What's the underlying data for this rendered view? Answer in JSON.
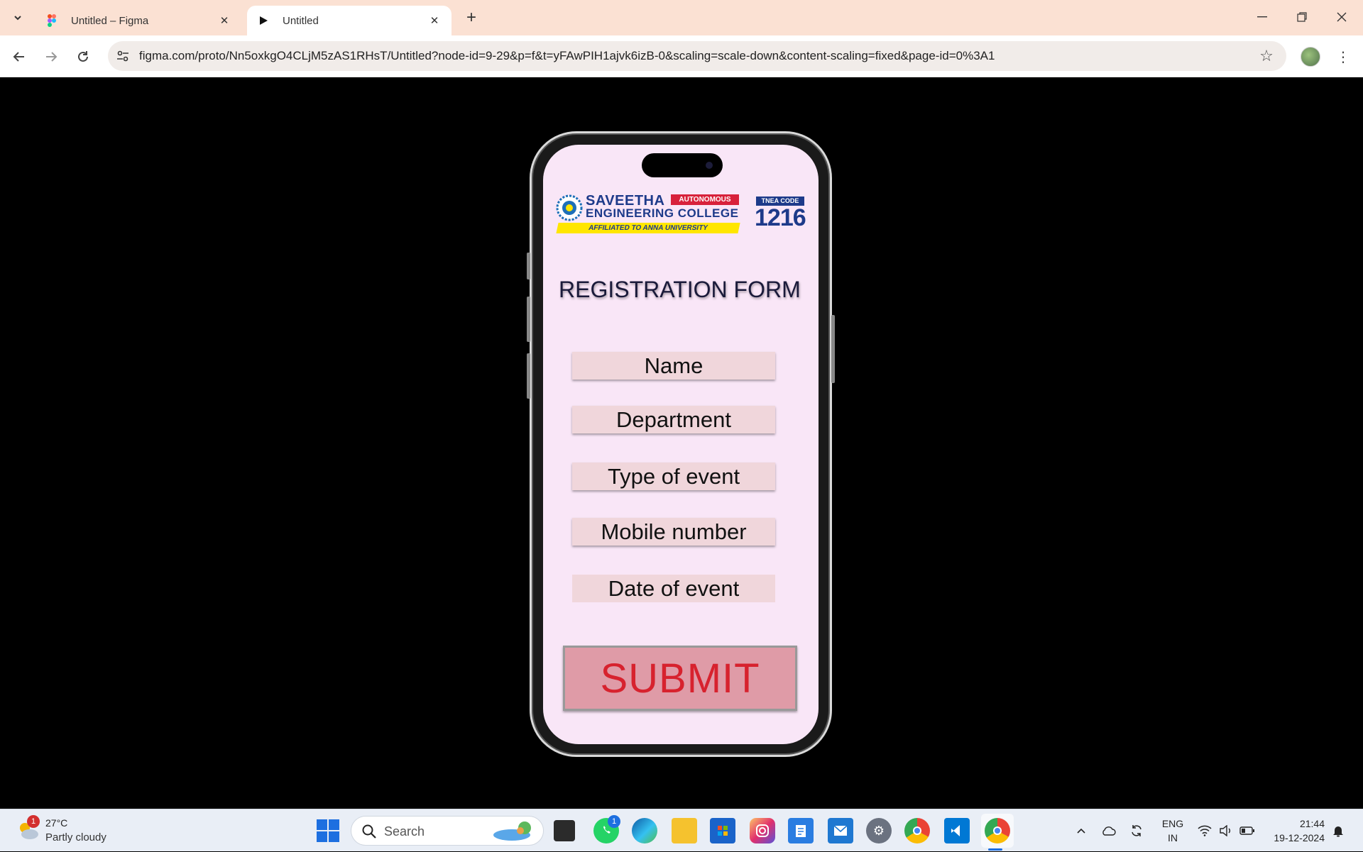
{
  "browser": {
    "tabs": [
      {
        "title": "Untitled – Figma",
        "active": false
      },
      {
        "title": "Untitled",
        "active": true
      }
    ],
    "url": "figma.com/proto/Nn5oxkgO4CLjM5zAS1RHsT/Untitled?node-id=9-29&p=f&t=yFAwPIH1ajvk6izB-0&scaling=scale-down&content-scaling=fixed&page-id=0%3A1"
  },
  "prototype": {
    "logo": {
      "name_line1": "SAVEETHA",
      "name_line2": "ENGINEERING COLLEGE",
      "autonomous": "AUTONOMOUS",
      "affiliation": "AFFILIATED TO ANNA UNIVERSITY",
      "tnea_label": "TNEA CODE",
      "tnea_code": "1216"
    },
    "title": "REGISTRATION FORM",
    "fields": [
      "Name",
      "Department",
      "Type of event",
      "Mobile number",
      "Date of event"
    ],
    "submit_label": "SUBMIT"
  },
  "taskbar": {
    "weather": {
      "badge": "1",
      "temp": "27°C",
      "condition": "Partly cloudy"
    },
    "search_placeholder": "Search",
    "whatsapp_badge": "1",
    "lang_line1": "ENG",
    "lang_line2": "IN",
    "time": "21:44",
    "date": "19-12-2024"
  },
  "colors": {
    "screen_bg": "#f9e6f7",
    "field_bg": "#f0d6db",
    "submit_bg": "#df9ba7",
    "submit_text": "#d7222e",
    "tabstrip_bg": "#fbe1d3"
  }
}
